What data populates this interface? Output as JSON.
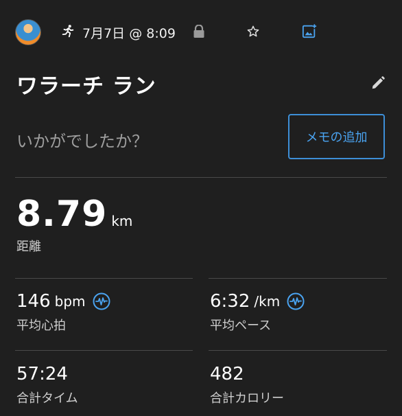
{
  "header": {
    "avatar_icon": "user-avatar",
    "activity_icon": "running-icon",
    "date_time": "7月7日 @ 8:09",
    "privacy_icon": "lock-icon",
    "favorite_icon": "star-icon",
    "add_photo_icon": "add-photo-icon"
  },
  "activity": {
    "title": "ワラーチ ラン",
    "edit_icon": "pencil-icon"
  },
  "notes": {
    "prompt": "いかがでしたか？",
    "add_button_label": "メモの追加"
  },
  "distance": {
    "value": "8.79",
    "unit": "km",
    "label": "距離"
  },
  "stats": [
    {
      "value": "146",
      "unit": "bpm",
      "label": "平均心拍",
      "icon": "heart-rate-icon"
    },
    {
      "value": "6:32",
      "unit": "/km",
      "label": "平均ペース",
      "icon": "heart-rate-icon"
    },
    {
      "value": "57:24",
      "unit": "",
      "label": "合計タイム"
    },
    {
      "value": "482",
      "unit": "",
      "label": "合計カロリー"
    }
  ],
  "colors": {
    "background": "#1f1f1f",
    "accent": "#3d8fd8",
    "divider": "#4a4a4a",
    "secondary_text": "#9e9e9e"
  }
}
